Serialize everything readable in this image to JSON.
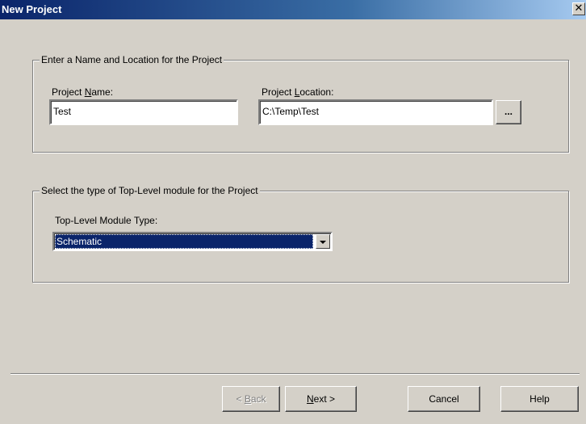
{
  "window": {
    "title": "New Project",
    "close_glyph": "✕"
  },
  "group_name_location": {
    "legend": "Enter a Name and Location for the Project",
    "project_name_label_before": "Project ",
    "project_name_label_mnemonic": "N",
    "project_name_label_after": "ame:",
    "project_name_value": "Test",
    "project_location_label_before": "Project ",
    "project_location_label_mnemonic": "L",
    "project_location_label_after": "ocation:",
    "project_location_value": "C:\\Temp\\Test",
    "browse_label": "..."
  },
  "group_top_level": {
    "legend": "Select the type of Top-Level module for the Project",
    "module_type_label": "Top-Level Module Type:",
    "module_type_selected": "Schematic"
  },
  "footer": {
    "back_label_before": "< ",
    "back_label_mnemonic": "B",
    "back_label_after": "ack",
    "next_label_mnemonic": "N",
    "next_label_after": "ext >",
    "cancel_label": "Cancel",
    "help_label": "Help"
  }
}
